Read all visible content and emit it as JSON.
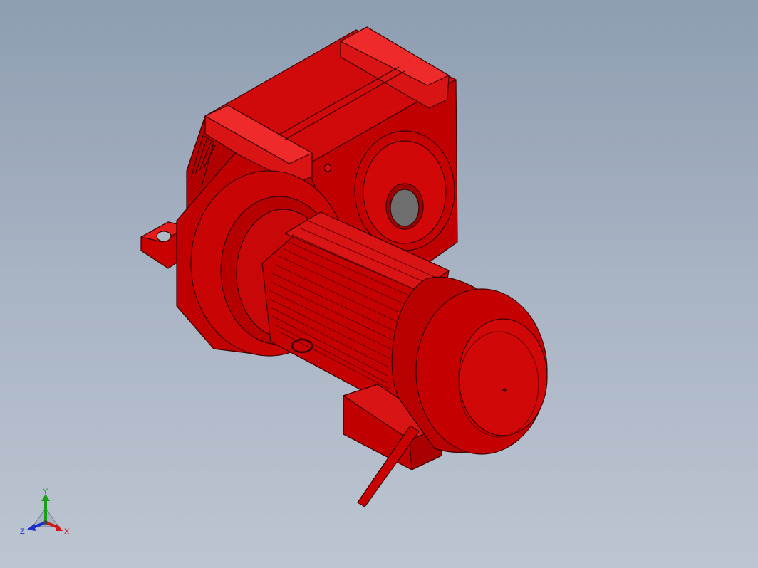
{
  "viewport": {
    "background_top": "#8e9db1",
    "background_bottom": "#bcc5d1"
  },
  "model": {
    "description_icon": "gearmotor-3d-model",
    "body_color": "#c80000",
    "shadow_color": "#8a0000",
    "highlight_color": "#e51c1c",
    "edge_color": "#3a0000",
    "shaft_bore_color": "#6e6e6e"
  },
  "triad": {
    "x_label": "X",
    "y_label": "Y",
    "z_label": "Z",
    "x_color": "#d01818",
    "y_color": "#18a018",
    "z_color": "#1830c8"
  }
}
